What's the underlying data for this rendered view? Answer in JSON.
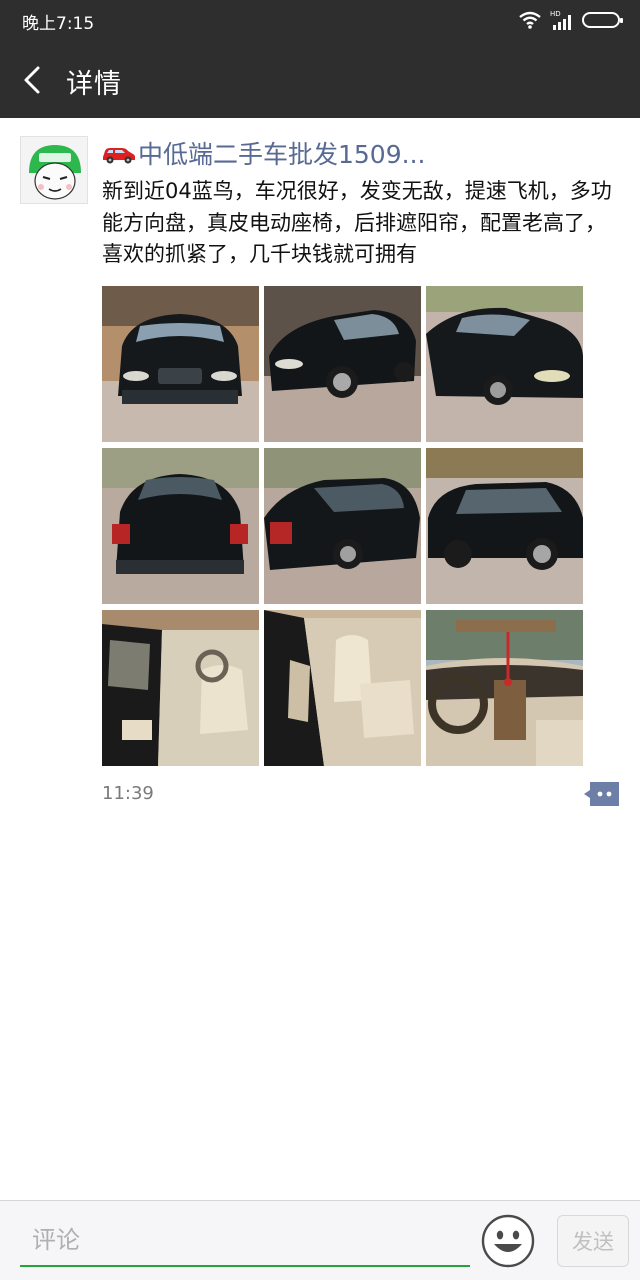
{
  "status_bar": {
    "time": "晚上7:15",
    "network_label": "HD",
    "icons": [
      "wifi-icon",
      "signal-icon",
      "battery-icon"
    ]
  },
  "nav": {
    "title": "详情",
    "back_icon": "back-arrow-icon"
  },
  "post": {
    "author": "中低端二手车批发1509...",
    "author_prefix_icon": "red-car-emoji-icon",
    "text": "新到近04蓝鸟，车况很好，发变无敌，提速飞机，多功能方向盘，真皮电动座椅，后排遮阳帘，配置老高了，喜欢的抓紧了，几千块钱就可拥有",
    "time": "11:39",
    "photos": [
      {
        "name": "photo-car-front"
      },
      {
        "name": "photo-car-front-left"
      },
      {
        "name": "photo-car-front-right"
      },
      {
        "name": "photo-car-rear"
      },
      {
        "name": "photo-car-rear-left"
      },
      {
        "name": "photo-car-side"
      },
      {
        "name": "photo-interior-front-door"
      },
      {
        "name": "photo-interior-seats"
      },
      {
        "name": "photo-interior-dashboard"
      }
    ],
    "comment_icon": "comment-bubble-icon"
  },
  "bottom_bar": {
    "comment_placeholder": "评论",
    "send_label": "发送",
    "emoji_icon": "smiley-emoji-icon"
  },
  "colors": {
    "header_bg": "#2e2e2e",
    "author_link": "#586a93",
    "input_underline": "#27a33b",
    "comment_icon": "#6d7fa6"
  }
}
